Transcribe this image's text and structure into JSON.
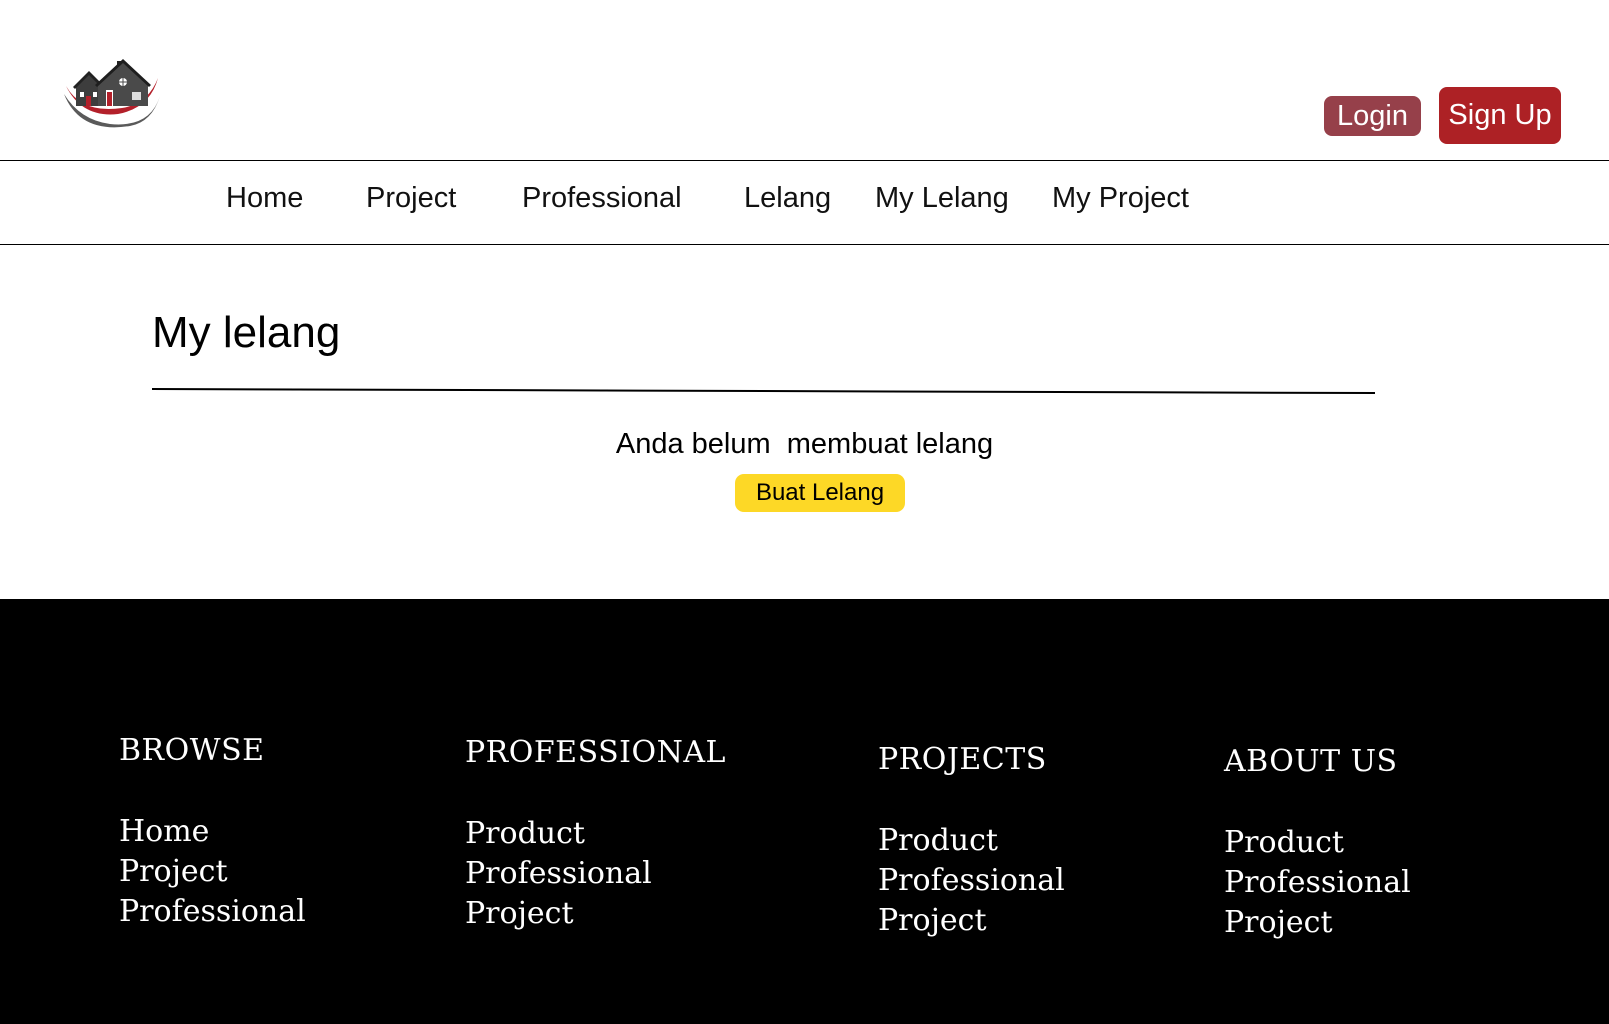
{
  "header": {
    "logo_icon": "house-logo-icon",
    "login_label": "Login",
    "signup_label": "Sign Up",
    "colors": {
      "login": "#96404a",
      "signup": "#ad2125"
    }
  },
  "nav": {
    "items": [
      {
        "label": "Home"
      },
      {
        "label": "Project"
      },
      {
        "label": "Professional"
      },
      {
        "label": "Lelang"
      },
      {
        "label": "My Lelang"
      },
      {
        "label": "My Project"
      }
    ]
  },
  "main": {
    "title": "My lelang",
    "empty_message": "Anda belum  membuat lelang",
    "create_button_label": "Buat Lelang",
    "create_button_color": "#fdd826"
  },
  "footer": {
    "columns": [
      {
        "heading": "BROWSE",
        "links": [
          "Home",
          "Project",
          "Professional"
        ]
      },
      {
        "heading": "PROFESSIONAL",
        "links": [
          "Product",
          "Professional",
          "Project"
        ]
      },
      {
        "heading": "PROJECTS",
        "links": [
          "Product",
          "Professional",
          "Project"
        ]
      },
      {
        "heading": "ABOUT US",
        "links": [
          "Product",
          "Professional",
          "Project"
        ]
      }
    ]
  }
}
